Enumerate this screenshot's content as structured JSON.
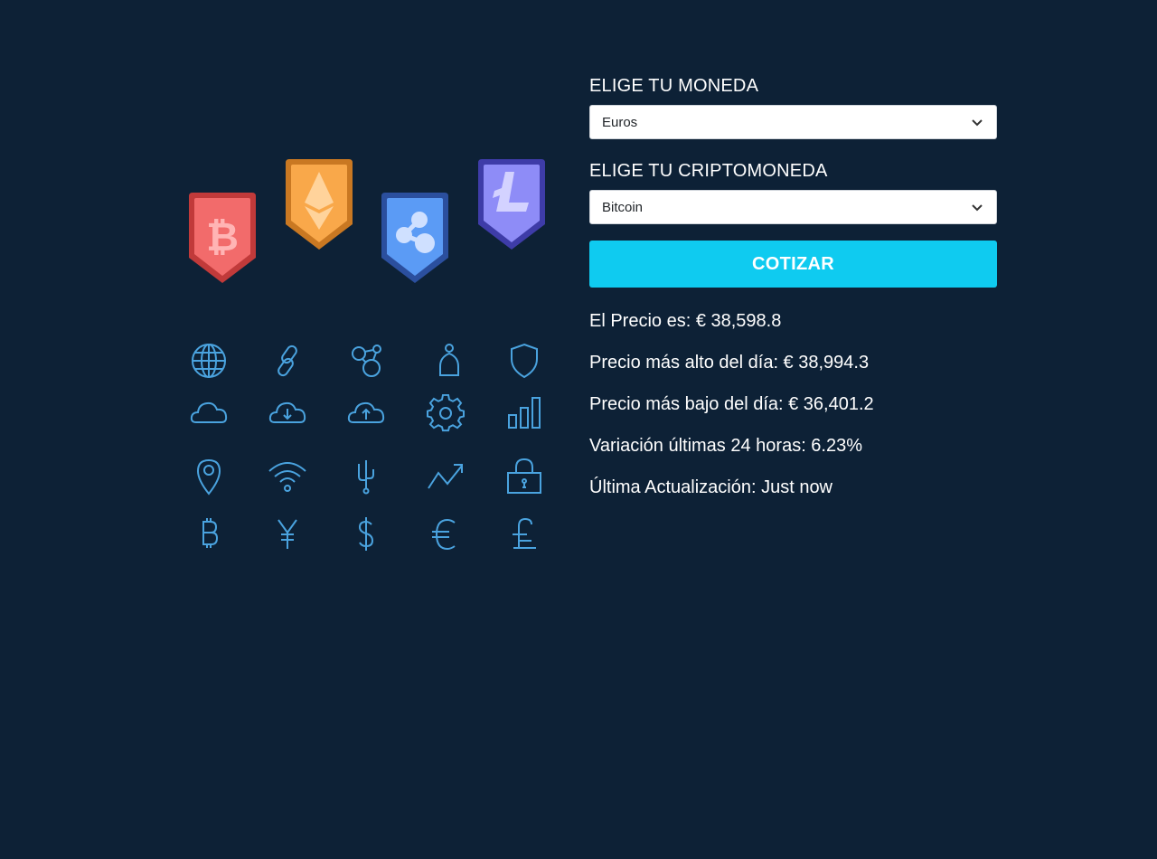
{
  "form": {
    "currency_label": "ELIGE TU MONEDA",
    "currency_value": "Euros",
    "crypto_label": "ELIGE TU CRIPTOMONEDA",
    "crypto_value": "Bitcoin",
    "quote_button": "COTIZAR"
  },
  "results": {
    "price": "El Precio es: € 38,598.8",
    "high": "Precio más alto del día: € 38,994.3",
    "low": "Precio más bajo del día: € 36,401.2",
    "change": "Variación últimas 24 horas: 6.23%",
    "updated": "Última Actualización: Just now"
  },
  "illustration": {
    "badges": [
      "bitcoin-badge",
      "ethereum-badge",
      "ripple-badge",
      "litecoin-badge"
    ],
    "badge_colors": [
      "#f26b6b",
      "#f9a84a",
      "#5b9bf5",
      "#8e8cf7"
    ],
    "icon_color": "#4aa3df",
    "icons": [
      "globe-icon",
      "link-icon",
      "network-icon",
      "user-icon",
      "shield-icon",
      "cloud-icon",
      "cloud-download-icon",
      "cloud-upload-icon",
      "gear-icon",
      "bar-chart-icon",
      "location-pin-icon",
      "wifi-icon",
      "usb-icon",
      "trend-up-icon",
      "lock-icon",
      "bitcoin-symbol-icon",
      "yen-icon",
      "dollar-icon",
      "euro-icon",
      "pound-icon"
    ]
  },
  "colors": {
    "background": "#0d2136",
    "accent": "#0fcbf0",
    "text": "#ffffff"
  }
}
